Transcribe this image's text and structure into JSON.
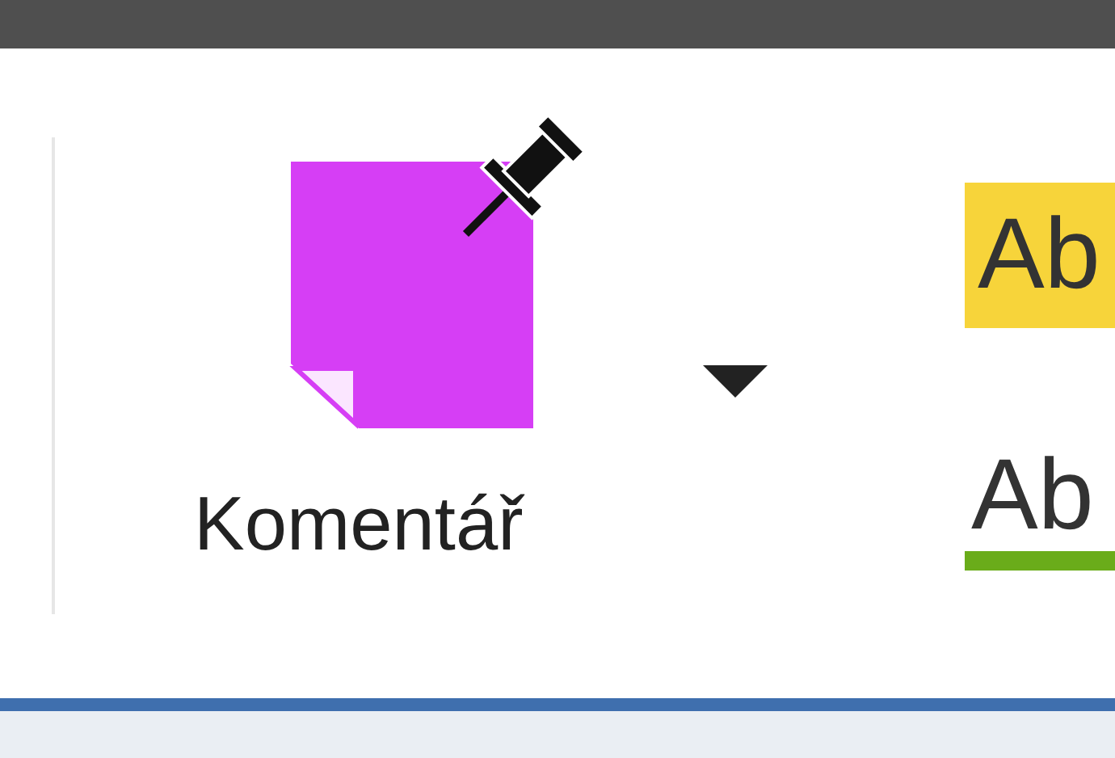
{
  "comment_button": {
    "label": "Komentář"
  },
  "styles": [
    {
      "label": "Ab",
      "kind": "highlight",
      "color": "#f7d43a"
    },
    {
      "label": "Ab",
      "kind": "underline",
      "color": "#6aac1a"
    }
  ]
}
